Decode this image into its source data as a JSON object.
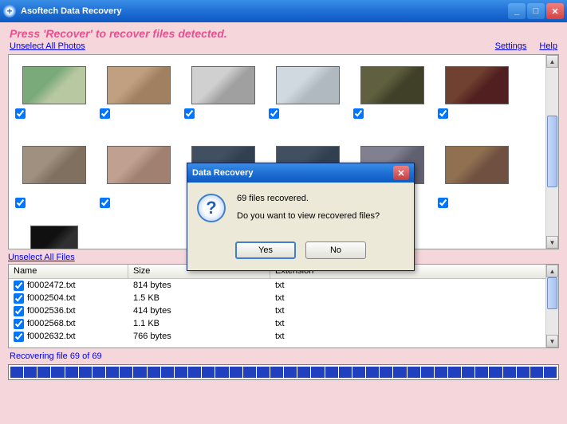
{
  "titlebar": {
    "title": "Asoftech Data Recovery"
  },
  "instruction": "Press 'Recover' to recover files detected.",
  "links": {
    "unselect_photos": "Unselect All Photos",
    "unselect_files": "Unselect All Files",
    "settings": "Settings",
    "help": "Help"
  },
  "files_table": {
    "headers": {
      "name": "Name",
      "size": "Size",
      "ext": "Extension"
    },
    "rows": [
      {
        "name": "f0002472.txt",
        "size": "814 bytes",
        "ext": "txt"
      },
      {
        "name": "f0002504.txt",
        "size": "1.5 KB",
        "ext": "txt"
      },
      {
        "name": "f0002536.txt",
        "size": "414 bytes",
        "ext": "txt"
      },
      {
        "name": "f0002568.txt",
        "size": "1.1 KB",
        "ext": "txt"
      },
      {
        "name": "f0002632.txt",
        "size": "766 bytes",
        "ext": "txt"
      }
    ]
  },
  "status": "Recovering file 69 of 69",
  "dialog": {
    "title": "Data Recovery",
    "line1": "69 files recovered.",
    "line2": "Do you want to view recovered files?",
    "yes": "Yes",
    "no": "No"
  }
}
